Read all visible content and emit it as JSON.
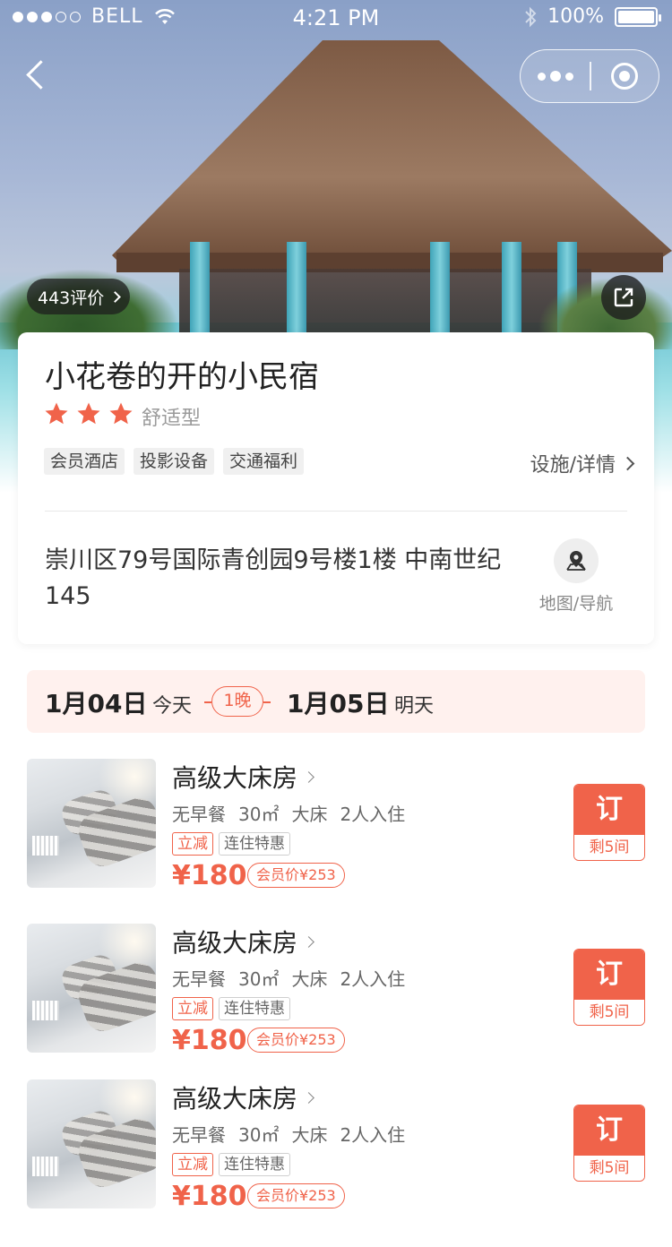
{
  "status_bar": {
    "carrier": "BELL",
    "time": "4:21 PM",
    "battery": "100%"
  },
  "hero": {
    "reviews_label": "443评价"
  },
  "hotel": {
    "name": "小花卷的开的小民宿",
    "star_count": 3,
    "type": "舒适型",
    "tags": [
      "会员酒店",
      "投影设备",
      "交通福利"
    ],
    "facility_link": "设施/详情",
    "address": "崇川区79号国际青创园9号楼1楼 中南世纪145",
    "map_label": "地图/导航"
  },
  "dates": {
    "checkin_date": "1月04日",
    "checkin_label": "今天",
    "nights": "1晚",
    "checkout_date": "1月05日",
    "checkout_label": "明天"
  },
  "rooms": [
    {
      "name": "高级大床房",
      "specs": [
        "无早餐",
        "30㎡",
        "大床",
        "2人入住"
      ],
      "tag_red": "立减",
      "tag_gray": "连住特惠",
      "price": "¥180",
      "member_price": "会员价¥253",
      "book_label": "订",
      "remaining": "剩5间"
    },
    {
      "name": "高级大床房",
      "specs": [
        "无早餐",
        "30㎡",
        "大床",
        "2人入住"
      ],
      "tag_red": "立减",
      "tag_gray": "连住特惠",
      "price": "¥180",
      "member_price": "会员价¥253",
      "book_label": "订",
      "remaining": "剩5间"
    },
    {
      "name": "高级大床房",
      "specs": [
        "无早餐",
        "30㎡",
        "大床",
        "2人入住"
      ],
      "tag_red": "立减",
      "tag_gray": "连住特惠",
      "price": "¥180",
      "member_price": "会员价¥253",
      "book_label": "订",
      "remaining": "剩5间"
    }
  ],
  "colors": {
    "accent": "#f0634a",
    "date_bar_bg": "#fff1ee",
    "star": "#f0634a"
  }
}
